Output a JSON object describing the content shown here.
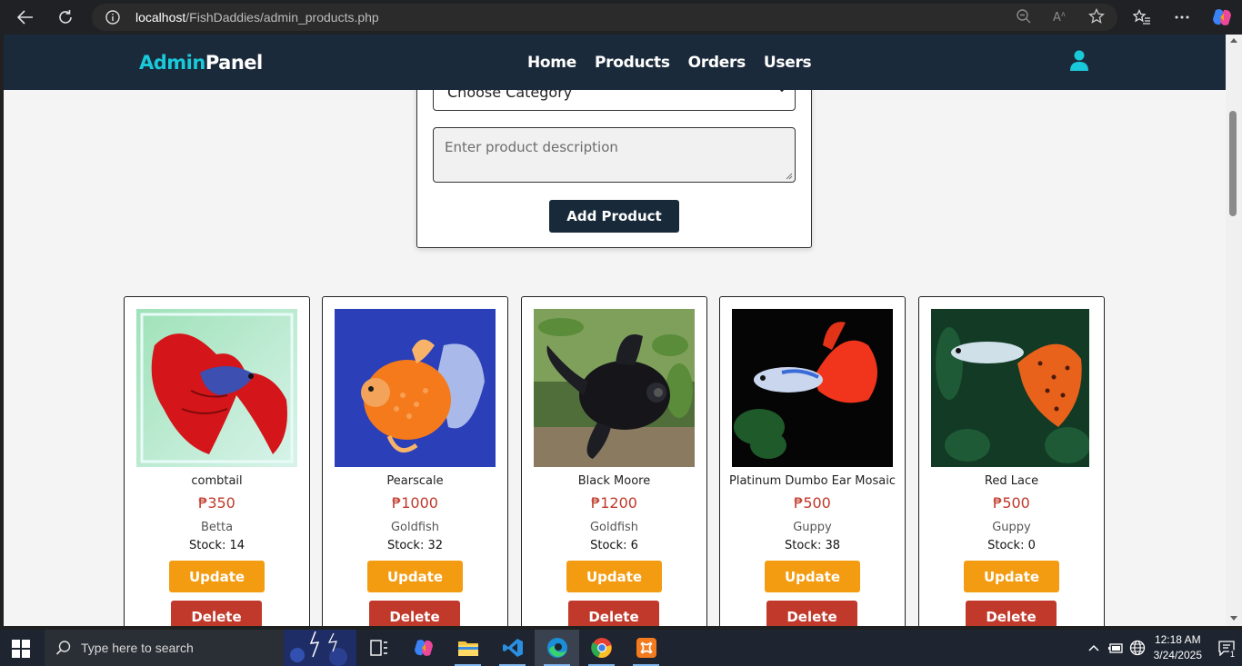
{
  "browser": {
    "url_host": "localhost",
    "url_path": "/FishDaddies/admin_products.php"
  },
  "header": {
    "brand_part1": "Admin",
    "brand_part2": "Panel",
    "nav": [
      "Home",
      "Products",
      "Orders",
      "Users"
    ],
    "accent_color": "#19c9d9",
    "bg_color": "#1b2a3a"
  },
  "form": {
    "category_selected": "Choose Category",
    "description_placeholder": "Enter product description",
    "add_button": "Add Product"
  },
  "products": [
    {
      "name": "combtail",
      "price": "₱350",
      "category": "Betta",
      "stock": "Stock: 14",
      "image": "red-betta-fish"
    },
    {
      "name": "Pearscale",
      "price": "₱1000",
      "category": "Goldfish",
      "stock": "Stock: 32",
      "image": "orange-pearlscale-goldfish"
    },
    {
      "name": "Black Moore",
      "price": "₱1200",
      "category": "Goldfish",
      "stock": "Stock: 6",
      "image": "black-moor-goldfish"
    },
    {
      "name": "Platinum Dumbo Ear Mosaic",
      "price": "₱500",
      "category": "Guppy",
      "stock": "Stock: 38",
      "image": "platinum-guppy"
    },
    {
      "name": "Red Lace",
      "price": "₱500",
      "category": "Guppy",
      "stock": "Stock: 0",
      "image": "red-lace-guppy"
    }
  ],
  "buttons": {
    "update": "Update",
    "delete": "Delete"
  },
  "taskbar": {
    "search_placeholder": "Type here to search",
    "time": "12:18 AM",
    "date": "3/24/2025",
    "notification_count": "1"
  }
}
